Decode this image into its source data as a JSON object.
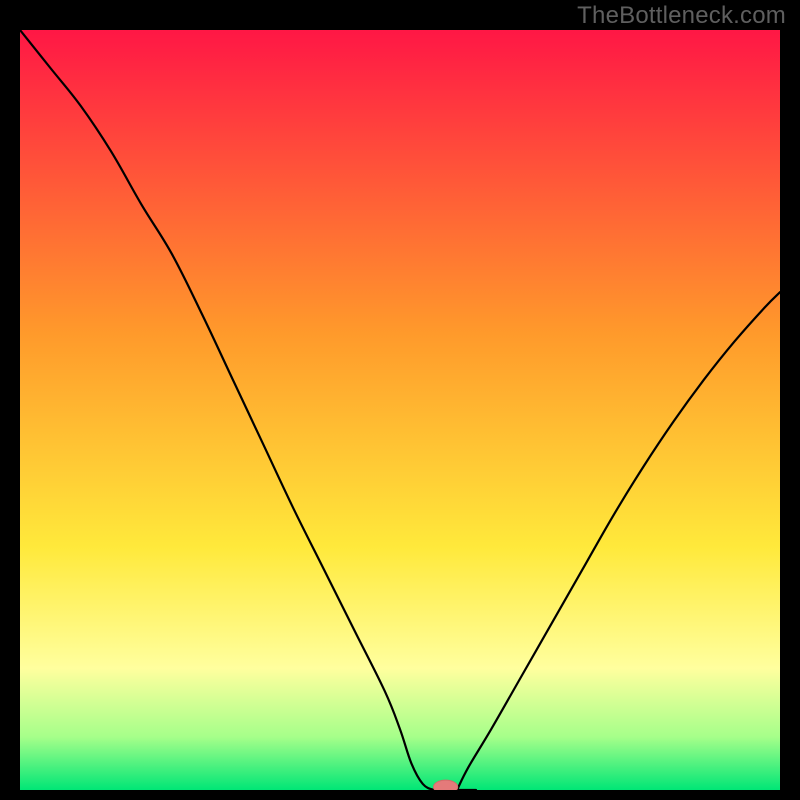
{
  "watermark": "TheBottleneck.com",
  "colors": {
    "bg_black": "#000000",
    "grad_top": "#ff1745",
    "grad_orange": "#ff9a2b",
    "grad_yellow": "#ffe93b",
    "grad_pale_yellow": "#ffff9e",
    "grad_light_green": "#a6ff8a",
    "grad_green": "#00e676",
    "curve": "#000000",
    "marker_fill": "#e47a7a",
    "marker_stroke": "#d46a6a"
  },
  "chart_data": {
    "type": "line",
    "title": "",
    "xlabel": "",
    "ylabel": "",
    "xlim": [
      0,
      100
    ],
    "ylim": [
      0,
      100
    ],
    "series": [
      {
        "name": "bottleneck-curve-left",
        "x": [
          0,
          4,
          8,
          12,
          16,
          20,
          24,
          28,
          32,
          36,
          40,
          44,
          48,
          50,
          51.5,
          53,
          54.5,
          55.5
        ],
        "values": [
          100,
          95,
          90,
          84,
          77,
          70.5,
          62.5,
          54,
          45.5,
          37,
          29,
          21,
          13,
          8,
          3.5,
          0.8,
          0,
          0
        ]
      },
      {
        "name": "bottleneck-curve-right",
        "x": [
          57.5,
          59,
          62,
          66,
          70,
          74,
          78,
          82,
          86,
          90,
          94,
          98,
          100
        ],
        "values": [
          0,
          3,
          8,
          15,
          22,
          29,
          36,
          42.5,
          48.5,
          54,
          59,
          63.5,
          65.5
        ]
      }
    ],
    "flat_bottom": {
      "x_start": 51.5,
      "x_end": 60,
      "y": 0
    },
    "marker": {
      "x": 56,
      "y": 0,
      "rx": 1.6,
      "ry": 0.9
    }
  }
}
